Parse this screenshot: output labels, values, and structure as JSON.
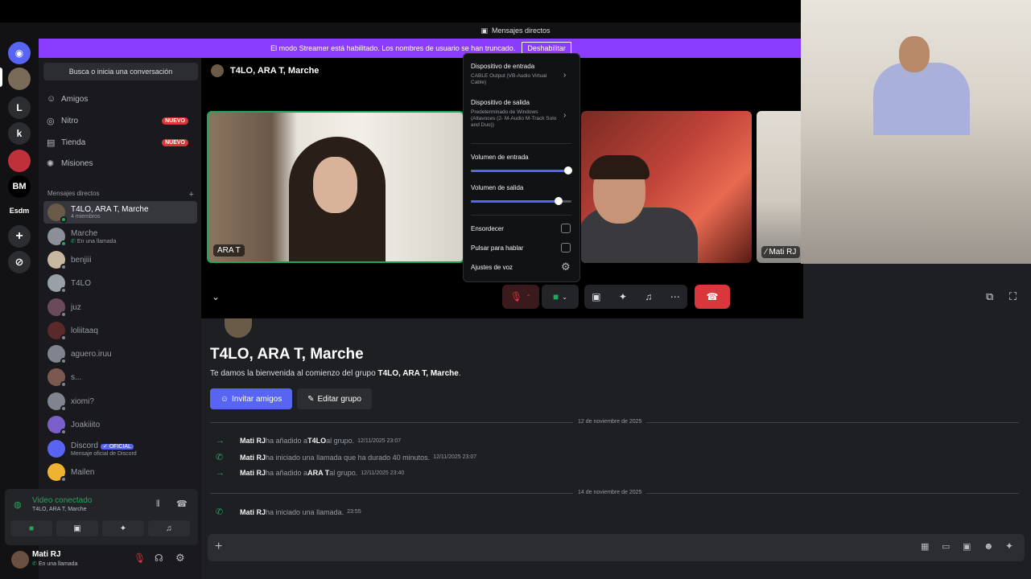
{
  "window": {
    "title": "Mensajes directos"
  },
  "banner": {
    "text": "El modo Streamer está habilitado. Los nombres de usuario se han truncado.",
    "button": "Deshabilitar"
  },
  "guilds": {
    "items": [
      "L",
      "k",
      "BM",
      "Esdm"
    ]
  },
  "sidebar": {
    "search_placeholder": "Busca o inicia una conversación",
    "nav": [
      {
        "label": "Amigos",
        "icon": "friends-icon"
      },
      {
        "label": "Nitro",
        "icon": "nitro-icon",
        "badge": "NUEVO"
      },
      {
        "label": "Tienda",
        "icon": "shop-icon",
        "badge": "NUEVO"
      },
      {
        "label": "Misiones",
        "icon": "quests-icon"
      }
    ],
    "dm_header": "Mensajes directos",
    "dm_add": "+",
    "dms": [
      {
        "name": "T4LO, ARA T, Marche",
        "sub": "4 miembros",
        "color": "#6a5a48"
      },
      {
        "name": "Marche",
        "sub": "En una llamada",
        "color": "#8a8f98"
      },
      {
        "name": "benjiii",
        "sub": "",
        "color": "#c9b8a0"
      },
      {
        "name": "T4LO",
        "sub": "",
        "color": "#9aa0a8"
      },
      {
        "name": "juz",
        "sub": "",
        "color": "#6b4a5a"
      },
      {
        "name": "loliitaaq",
        "sub": "",
        "color": "#5a2a2a"
      },
      {
        "name": "aguero.iruu",
        "sub": "",
        "color": "#80848e"
      },
      {
        "name": "s...",
        "sub": "",
        "color": "#7a5a50"
      },
      {
        "name": "xiomi?",
        "sub": "",
        "color": "#80848e"
      },
      {
        "name": "Joakiiito",
        "sub": "",
        "color": "#7b5ec9"
      },
      {
        "name": "Discord",
        "sub": "Mensaje oficial de Discord",
        "badge": "OFICIAL",
        "color": "#5865f2"
      },
      {
        "name": "Mailen",
        "sub": "",
        "color": "#f0b232"
      }
    ]
  },
  "voice": {
    "status": "Video conectado",
    "channel": "T4LO, ARA T, Marche"
  },
  "user": {
    "name": "Mati RJ",
    "status": "En una llamada"
  },
  "call": {
    "header": "T4LO, ARA T, Marche",
    "tiles": [
      {
        "label": "ARA T"
      },
      {
        "label": ""
      },
      {
        "label": "Mati RJ"
      }
    ]
  },
  "popup": {
    "input_device_label": "Dispositivo de entrada",
    "input_device_value": "CABLE Output (VB-Audio Virtual Cable)",
    "output_device_label": "Dispositivo de salida",
    "output_device_value": "Predeterminado de Windows (Altavoces (2- M-Audio M-Track Solo and Duo))",
    "input_volume_label": "Volumen de entrada",
    "input_volume": 0.97,
    "output_volume_label": "Volumen de salida",
    "output_volume": 0.87,
    "deafen": "Ensordecer",
    "push_to_talk": "Pulsar para hablar",
    "voice_settings": "Ajustes de voz"
  },
  "chat": {
    "title": "T4LO, ARA T, Marche",
    "welcome_prefix": "Te damos la bienvenida al comienzo del grupo ",
    "welcome_group": "T4LO, ARA T, Marche",
    "welcome_suffix": ".",
    "invite_button": "Invitar amigos",
    "edit_button": "Editar grupo",
    "date1": "12 de noviembre de 2025",
    "date2": "14 de noviembre de 2025",
    "messages": [
      {
        "author": "Mati RJ",
        "text1": " ha añadido a ",
        "target": "T4LO",
        "text2": " al grupo.",
        "ts": "12/11/2025 23:07"
      },
      {
        "author": "Mati RJ",
        "text1": " ha iniciado una llamada que ha durado 40 minutos.",
        "target": "",
        "text2": "",
        "ts": "12/11/2025 23:07"
      },
      {
        "author": "Mati RJ",
        "text1": " ha añadido a ",
        "target": "ARA T",
        "text2": " al grupo.",
        "ts": "12/11/2025 23:40"
      },
      {
        "author": "Mati RJ",
        "text1": " ha iniciado una llamada.",
        "target": "",
        "text2": "",
        "ts": "23:55"
      }
    ]
  },
  "colors": {
    "accent": "#5865f2",
    "streamer_banner": "#8b3dff",
    "danger": "#da373c",
    "online": "#23a55a"
  }
}
